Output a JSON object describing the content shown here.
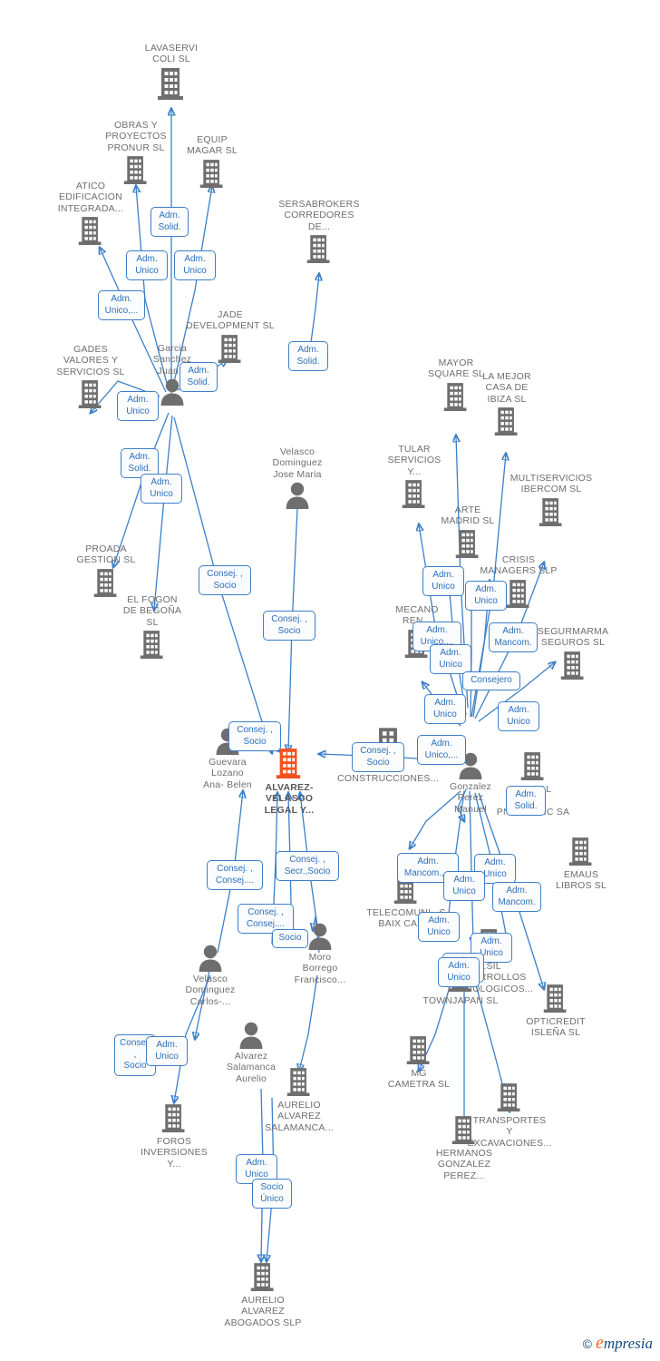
{
  "diagram": {
    "title": "ALVAREZ-VELASCO LEGAL Y... corporate relationship network",
    "root_color": "#f4511e",
    "node_color": "#6e6e6e",
    "edge_color": "#3d7fc7",
    "chip_text_color": "#2c6fbb"
  },
  "watermark": {
    "copyright": "©",
    "brand_first": "e",
    "brand_rest": "mpresia"
  },
  "nodes": [
    {
      "id": "lavaservi",
      "label": "LAVASERVI\nCOLI  SL",
      "type": "company"
    },
    {
      "id": "obras",
      "label": "OBRAS Y\nPROYECTOS\nPRONUR SL",
      "type": "company"
    },
    {
      "id": "equip",
      "label": "EQUIP\nMAGAR  SL",
      "type": "company"
    },
    {
      "id": "atico",
      "label": "ATICO\nEDIFICACION\nINTEGRADA...",
      "type": "company"
    },
    {
      "id": "sersabrokers",
      "label": "SERSABROKERS\nCORREDORES\nDE...",
      "type": "company"
    },
    {
      "id": "jade",
      "label": "JADE\nDEVELOPMENT SL",
      "type": "company"
    },
    {
      "id": "gades",
      "label": "GADES\nVALORES Y\nSERVICIOS  SL",
      "type": "company"
    },
    {
      "id": "garcia",
      "label": "Garcia\nSanchez\nJuan...",
      "type": "person"
    },
    {
      "id": "proada",
      "label": "PROADA\nGESTION  SL",
      "type": "company"
    },
    {
      "id": "fogon",
      "label": "EL FOGON\nDE BEGOÑA\nSL",
      "type": "company"
    },
    {
      "id": "velascojm",
      "label": "Velasco\nDominguez\nJose Maria",
      "type": "person"
    },
    {
      "id": "mayor",
      "label": "MAYOR\nSQUARE  SL",
      "type": "company"
    },
    {
      "id": "lamejor",
      "label": "LA MEJOR\nCASA DE\nIBIZA  SL",
      "type": "company"
    },
    {
      "id": "tular",
      "label": "TULAR\nSERVICIOS\nY...",
      "type": "company"
    },
    {
      "id": "multiservicios",
      "label": "MULTISERVICIOS\nIBERCOM SL",
      "type": "company"
    },
    {
      "id": "arte",
      "label": "ARTE\nMADRID SL",
      "type": "company"
    },
    {
      "id": "crisis",
      "label": "CRISIS\nMANAGERS SLP",
      "type": "company"
    },
    {
      "id": "mecano",
      "label": "MECANO\nREN...",
      "type": "company"
    },
    {
      "id": "segurmarma",
      "label": "SEGURMARMA\nSEGUROS SL",
      "type": "company"
    },
    {
      "id": "ingenieria",
      "label": "...IA\nY\nCONSTRUCCIONES...",
      "type": "company"
    },
    {
      "id": "guevara",
      "label": "Guevara\nLozano\nAna- Belen",
      "type": "person"
    },
    {
      "id": "root",
      "label": "ALVAREZ-\nVELASCO\nLEGAL Y...",
      "type": "root"
    },
    {
      "id": "gonzalez",
      "label": "Gonzalez\nPerez\nManuel",
      "type": "person"
    },
    {
      "id": "pneumatic",
      "label": "E...ICAL\nOF\nPNEUMATIC SA",
      "type": "company"
    },
    {
      "id": "emaus",
      "label": "EMAUS\nLIBROS SL",
      "type": "company"
    },
    {
      "id": "telecom",
      "label": "TELECOMUNI...S\nBAIX CAM...",
      "type": "company"
    },
    {
      "id": "velascocarlos",
      "label": "Velasco\nDominguez\nCarlos-...",
      "type": "person"
    },
    {
      "id": "moro",
      "label": "Moro\nBorrego\nFrancisco...",
      "type": "person"
    },
    {
      "id": "alvarezsal",
      "label": "Alvarez\nSalamanca\nAurelio",
      "type": "person"
    },
    {
      "id": "aureliosl",
      "label": "AURELIO\nALVAREZ\nSALAMANCA...",
      "type": "company"
    },
    {
      "id": "desarrollos",
      "label": "...SIL\nDESARROLLOS\nTECNOLOGICOS...",
      "type": "company"
    },
    {
      "id": "townjapan",
      "label": "TOWNJAPAN SL",
      "type": "company"
    },
    {
      "id": "opticredit",
      "label": "OPTICREDIT\nISLEÑA SL",
      "type": "company"
    },
    {
      "id": "mgcametra",
      "label": "MG\nCAMETRA  SL",
      "type": "company"
    },
    {
      "id": "transportes",
      "label": "TRANSPORTES\nY\nEXCAVACIONES...",
      "type": "company"
    },
    {
      "id": "hermanos",
      "label": "HERMANOS\nGONZALEZ\nPEREZ...",
      "type": "company"
    },
    {
      "id": "foros",
      "label": "FOROS\nINVERSIONES\nY...",
      "type": "company"
    },
    {
      "id": "aurelioabog",
      "label": "AURELIO\nALVAREZ\nABOGADOS  SLP",
      "type": "company"
    }
  ],
  "chips": [
    {
      "id": "c01",
      "label": "Adm.\nSolid."
    },
    {
      "id": "c02",
      "label": "Adm.\nUnico"
    },
    {
      "id": "c03",
      "label": "Adm.\nUnico"
    },
    {
      "id": "c04",
      "label": "Adm.\nUnico,..."
    },
    {
      "id": "c05",
      "label": "Adm.\nSolid."
    },
    {
      "id": "c06",
      "label": "Adm.\nSolid."
    },
    {
      "id": "c07",
      "label": "Adm.\nUnico"
    },
    {
      "id": "c08",
      "label": "Adm.\nSolid."
    },
    {
      "id": "c09",
      "label": "Adm.\nUnico"
    },
    {
      "id": "c10",
      "label": "Consej. ,\nSocio"
    },
    {
      "id": "c11",
      "label": "Consej. ,\nSocio"
    },
    {
      "id": "c12",
      "label": "Consej. ,\nSocio"
    },
    {
      "id": "c13",
      "label": "Consej. ,\nSocio"
    },
    {
      "id": "c14",
      "label": "Consej. ,\nSocio"
    },
    {
      "id": "c15",
      "label": "Adm.\nUnico"
    },
    {
      "id": "c16",
      "label": "Adm.\nUnico"
    },
    {
      "id": "c17",
      "label": "Adm.\nUnico,..."
    },
    {
      "id": "c18",
      "label": "Adm.\nMancom."
    },
    {
      "id": "c19",
      "label": "Adm.\nUnico"
    },
    {
      "id": "c20",
      "label": "Consejero"
    },
    {
      "id": "c21",
      "label": "Adm.\nUnico"
    },
    {
      "id": "c22",
      "label": "Adm.\nUnico"
    },
    {
      "id": "c23",
      "label": "Adm.\nUnico,..."
    },
    {
      "id": "c24",
      "label": "Adm.\nSolid."
    },
    {
      "id": "c25",
      "label": "Adm.\nMancom.,..."
    },
    {
      "id": "c26",
      "label": "Adm.\nUnico"
    },
    {
      "id": "c27",
      "label": "Adm.\nUnico"
    },
    {
      "id": "c28",
      "label": "Adm.\nMancom."
    },
    {
      "id": "c29",
      "label": "Adm.\nUnico"
    },
    {
      "id": "c30",
      "label": "Adm.\nUnico"
    },
    {
      "id": "c31",
      "label": "Adm.\nUnico"
    },
    {
      "id": "c32",
      "label": "Adm.\nUnico"
    },
    {
      "id": "c33",
      "label": "Consej. ,\nConsej...."
    },
    {
      "id": "c34",
      "label": "Consej. ,\nSecr.,Socio"
    },
    {
      "id": "c35",
      "label": "Consej. ,\nConsej...."
    },
    {
      "id": "c36",
      "label": "Socio"
    },
    {
      "id": "c37",
      "label": "Adm.\nUnico"
    },
    {
      "id": "c38",
      "label": "Adm.\nUnico"
    },
    {
      "id": "c39",
      "label": "Socio\nÚnico"
    }
  ]
}
